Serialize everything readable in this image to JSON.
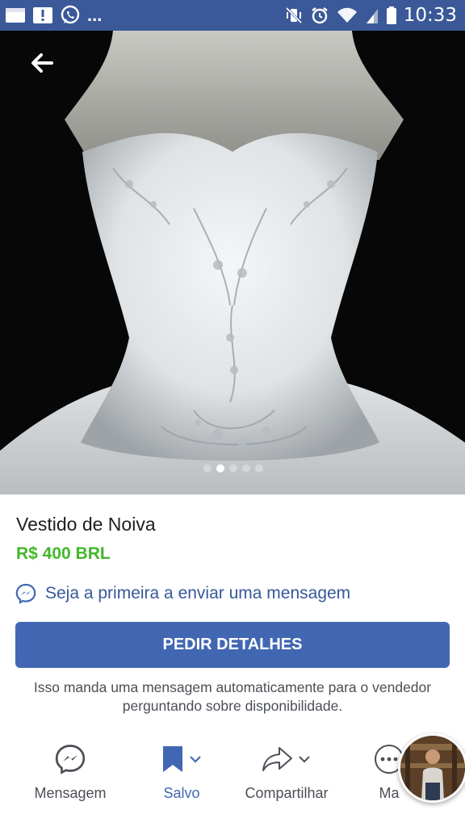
{
  "status_bar": {
    "time": "10:33",
    "overflow": "...",
    "left_icons": [
      "notification-card-icon",
      "alert-icon",
      "whatsapp-icon"
    ],
    "right_icons": [
      "mute-vibrate-icon",
      "alarm-icon",
      "wifi-icon",
      "signal-icon",
      "battery-icon"
    ]
  },
  "colors": {
    "status_bar": "#3b5998",
    "price": "#42b72a",
    "link": "#365899",
    "button": "#4267b2",
    "saved": "#4267b2"
  },
  "listing": {
    "title": "Vestido de Noiva",
    "price": "R$ 400 BRL",
    "message_link": "Seja a primeira a enviar uma mensagem",
    "button_label": "PEDIR DETALHES",
    "helper_text": "Isso manda uma mensagem automaticamente para o vendedor perguntando sobre disponibilidade."
  },
  "carousel": {
    "count": 5,
    "active_index": 1
  },
  "actions": [
    {
      "label": "Mensagem",
      "icon": "messenger-icon"
    },
    {
      "label": "Salvo",
      "icon": "bookmark-icon",
      "active": true
    },
    {
      "label": "Compartilhar",
      "icon": "share-icon"
    },
    {
      "label": "Ma",
      "icon": "more-icon"
    }
  ]
}
